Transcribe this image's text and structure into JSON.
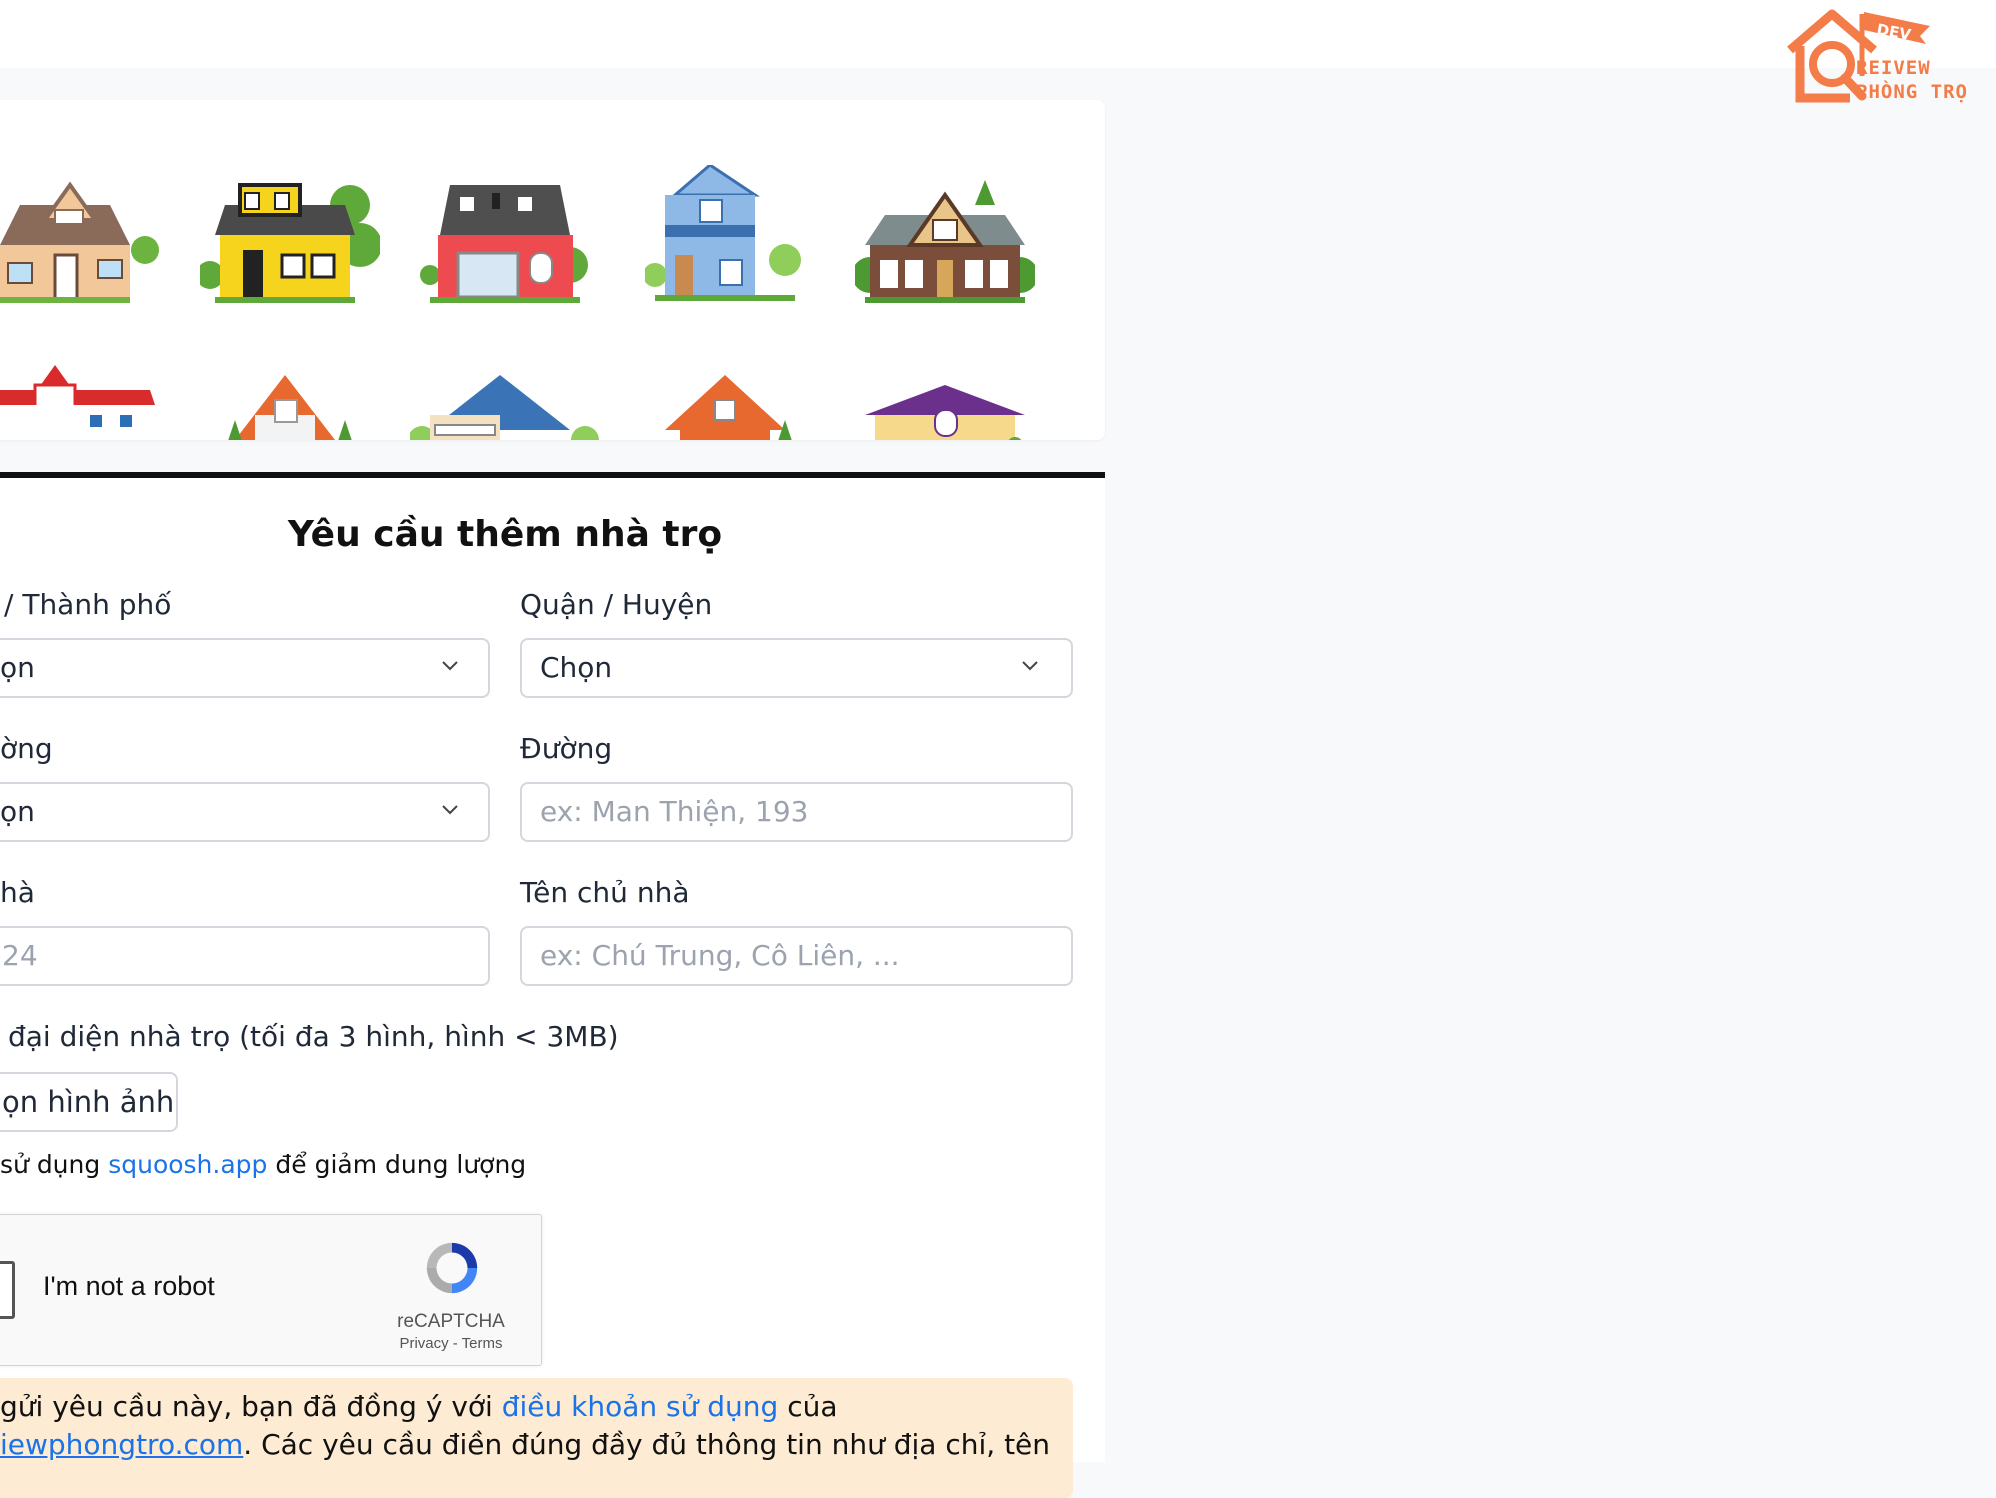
{
  "logo": {
    "badge": "DEV",
    "line1": "REIVEW",
    "line2": "PHÒNG TRỌ"
  },
  "form": {
    "title": "Yêu cầu thêm nhà trọ",
    "province": {
      "label": "/ Thành phố",
      "value": "ọn"
    },
    "district": {
      "label": "Quận / Huyện",
      "value": "Chọn"
    },
    "ward": {
      "label": "ờng",
      "value": "ọn"
    },
    "street": {
      "label": "Đường",
      "placeholder": "ex: Man Thiện, 193"
    },
    "house_number": {
      "label": "hà",
      "placeholder": "24"
    },
    "owner": {
      "label": "Tên chủ nhà",
      "placeholder": "ex: Chú Trung, Cô Liên, ..."
    },
    "images": {
      "label": "đại diện nhà trọ (tối đa 3 hình, hình < 3MB)",
      "button": "ọn hình ảnh",
      "hint_prefix": "sử dụng",
      "hint_link": "squoosh.app",
      "hint_suffix": "để giảm dung lượng"
    }
  },
  "captcha": {
    "label": "I'm not a robot",
    "brand": "reCAPTCHA",
    "links": "Privacy - Terms"
  },
  "notice": {
    "line1_prefix": "gửi yêu cầu này, bạn đã đồng ý với",
    "line1_link": "điều khoản sử dụng",
    "line1_suffix": "của",
    "line2_link": "iewphongtro.com",
    "line2_suffix": ". Các yêu cầu điền đúng đầy đủ thông tin như địa chỉ, tên"
  },
  "colors": {
    "accent": "#f47c48",
    "link": "#1a73e8",
    "notice_bg": "#fdebd3"
  }
}
